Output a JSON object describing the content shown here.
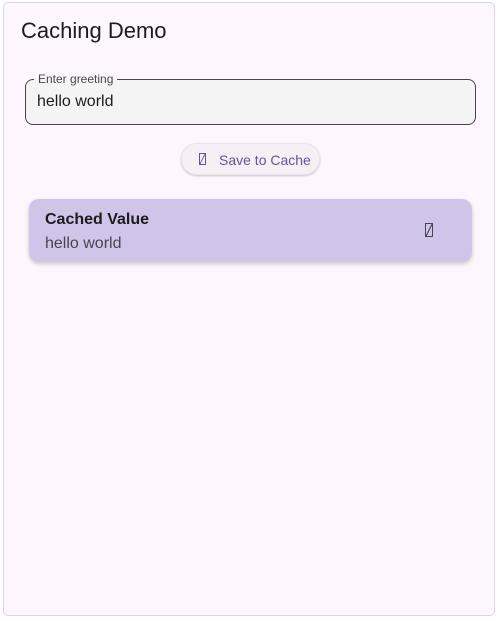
{
  "app": {
    "title": "Caching Demo"
  },
  "greeting_input": {
    "label": "Enter greeting",
    "value": "hello world"
  },
  "save_button": {
    "label": "Save to Cache",
    "icon": "save-icon"
  },
  "cached_card": {
    "title": "Cached Value",
    "value": "hello world",
    "action_icon": "delete-icon"
  },
  "colors": {
    "background": "#fdf7fd",
    "primary": "#65558f",
    "card": "#d0c5e8",
    "text": "#1d1b20",
    "secondary_text": "#49454f"
  }
}
